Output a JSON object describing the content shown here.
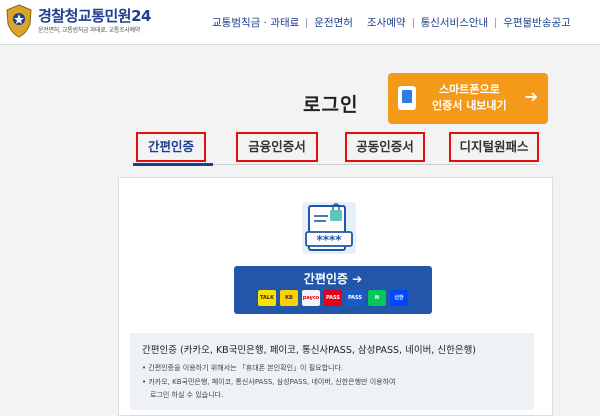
{
  "header": {
    "title": "경찰청교통민원24",
    "subtitle": "운전면허, 교통범칙금 과태료, 교통조사예약",
    "nav": [
      "교통범칙금 · 과태료",
      "운전면허",
      "조사예약",
      "통신서비스안내",
      "우편물반송공고"
    ]
  },
  "page_title": "로그인",
  "smartphone_button": {
    "line1": "스마트폰으로",
    "line2": "인증서 내보내기",
    "arrow": "➔"
  },
  "tabs": [
    "간편인증",
    "금융인증서",
    "공동인증서",
    "디지털원패스"
  ],
  "doc_icon": {
    "stars": "****"
  },
  "simple_auth_button": {
    "label": "간편인증 ➔"
  },
  "providers": [
    {
      "name": "TALK",
      "bg": "#fae100",
      "fg": "#3c1e1e"
    },
    {
      "name": "KB",
      "bg": "#fdd000",
      "fg": "#333"
    },
    {
      "name": "payco",
      "bg": "#f3f3f3",
      "fg": "#e60012"
    },
    {
      "name": "PASS",
      "bg": "#e2001a",
      "fg": "#fff"
    },
    {
      "name": "PASS",
      "bg": "#1c5cc7",
      "fg": "#fff"
    },
    {
      "name": "N",
      "bg": "#03c75a",
      "fg": "#fff"
    },
    {
      "name": "신한",
      "bg": "#0046ff",
      "fg": "#fff"
    }
  ],
  "info": {
    "title": "간편인증 (카카오, KB국민은행, 페이코, 통신사PASS, 삼성PASS, 네이버, 신한은행)",
    "line1": "• 간편인증을 이용하기 위해서는 「휴대폰 본인확인」이 필요합니다.",
    "line2": "• 카카오, KB국민은행, 페이코, 통신사PASS, 삼성PASS, 네이버, 신한은행만 이용하여",
    "line3": "로그인 하실 수 있습니다."
  }
}
